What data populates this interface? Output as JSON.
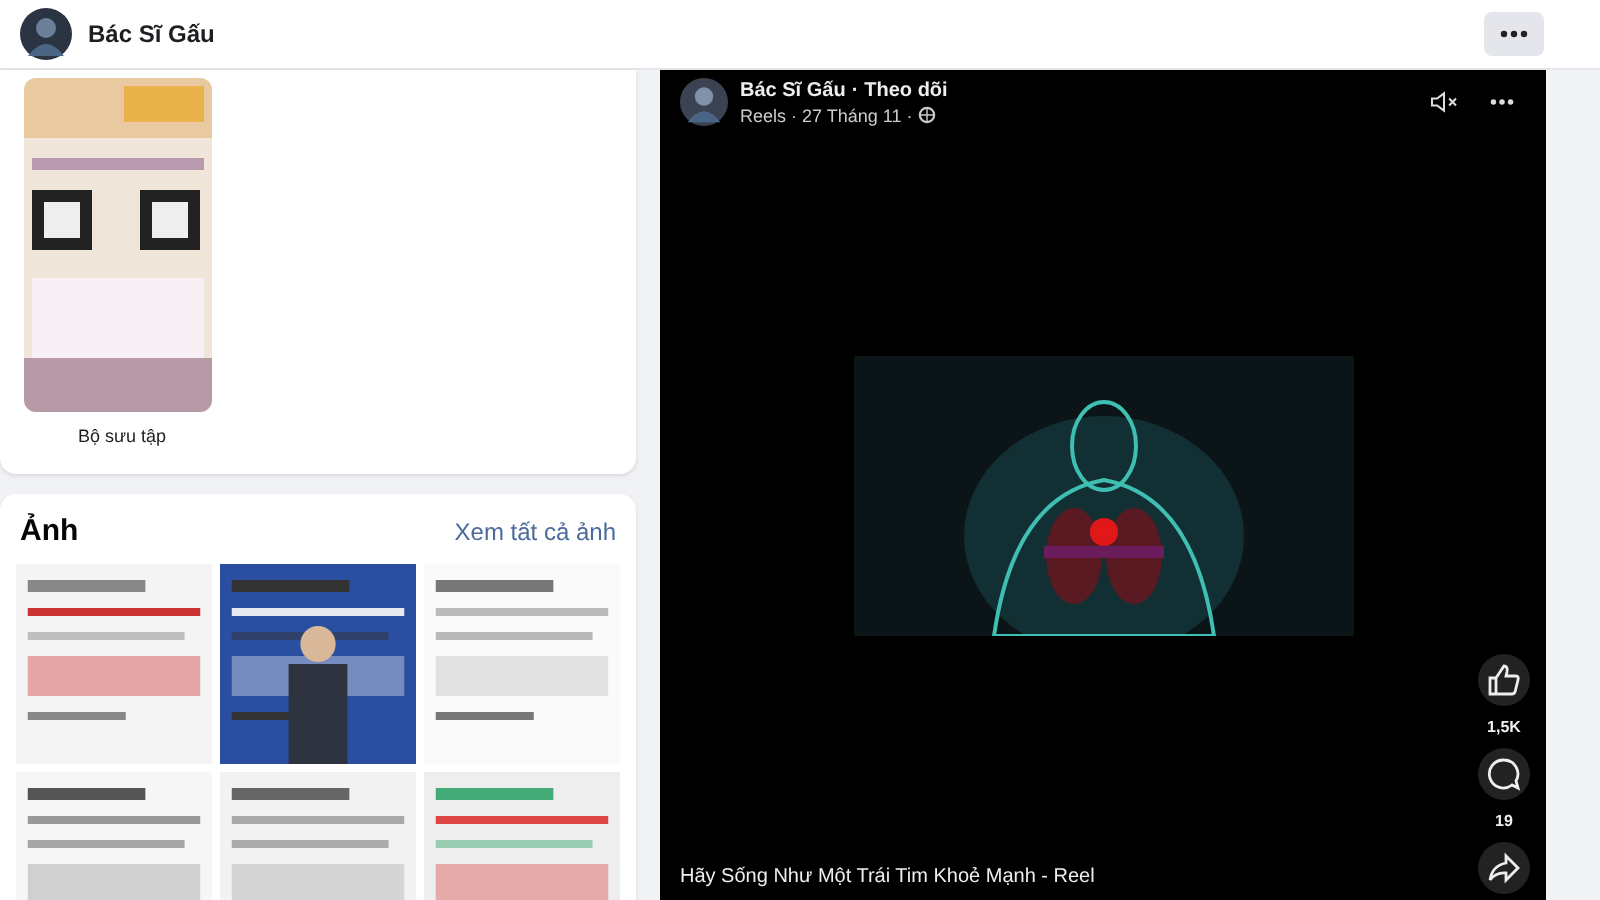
{
  "header": {
    "name": "Bác Sĩ Gấu"
  },
  "collection": {
    "label": "Bộ sưu tập"
  },
  "photos": {
    "title": "Ảnh",
    "link": "Xem tất cả ảnh"
  },
  "reel": {
    "author": "Bác Sĩ Gấu",
    "separator": "·",
    "follow": "Theo dõi",
    "meta": "Reels · 27 Tháng 11 ·",
    "muted": true,
    "actions": [
      {
        "kind": "like",
        "count": "1,5K"
      },
      {
        "kind": "comment",
        "count": "19"
      },
      {
        "kind": "share"
      }
    ],
    "caption": "Hãy Sống Như Một Trái Tim Khoẻ Mạnh - Reel"
  }
}
